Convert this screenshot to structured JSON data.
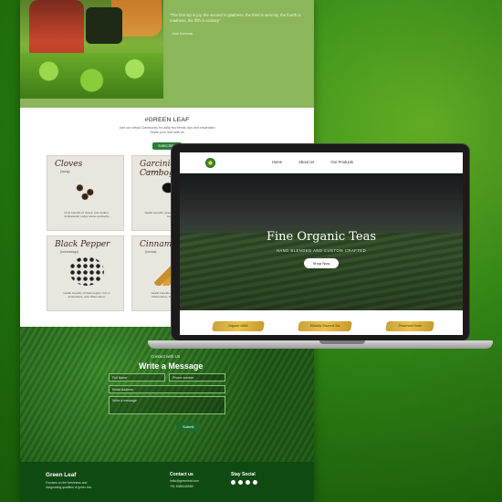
{
  "hero": {
    "quote": "\"The first sip is joy, the second is gladness, the third is serenity, the fourth is madness, the fifth is ecstasy\"",
    "author": "- Jack Kerouac"
  },
  "green_leaf_section": {
    "title": "#GREEN LEAF",
    "subtitle_line1": "Join our virtual Community for daily tea trends, tips and inspiration",
    "subtitle_line2": "Share your love with us",
    "subscribe_label": "SUBSCRIBE"
  },
  "products": [
    {
      "name": "Cloves",
      "subtitle": "(laung)",
      "desc": "Knife benefits of cloves: Anti-oxidant, Antibacterial, Helps relieve toothache"
    },
    {
      "name": "Garcinia Cambogia",
      "subtitle": "(kudampuli)",
      "desc": "Health benefits: Appetite control, weight loss support"
    },
    {
      "name": "Black Pepper",
      "subtitle": "(kurumulagu)",
      "desc": "Health benefits of black pepper: rich in antioxidants, anti-inflammatory"
    },
    {
      "name": "Cinnamon",
      "subtitle": "(kuruva)",
      "desc": "Health benefits of cinnamon: anti-inflammatory, lowers blood sugar"
    }
  ],
  "contact": {
    "small": "Contact with Us",
    "title": "Write a Message",
    "full_name": "Full Name",
    "phone": "Phone number",
    "email": "Email Address",
    "message": "Write a message",
    "submit_label": "Submit"
  },
  "footer": {
    "brand": "Green Leaf",
    "desc": "Focuses on the freshness and invigorating qualities of green tea.",
    "contact_title": "Contact us",
    "email": "hello@greenleaf.com",
    "phone": "+91 6385446968",
    "social_title": "Stay Social"
  },
  "laptop": {
    "nav": [
      "Home",
      "About Us",
      "Our Products"
    ],
    "banner_title": "Fine Organic Teas",
    "banner_sub": "HAND BLENDED AND CUSTOM CRAFTED",
    "shop_label": "Shop Now",
    "badges": [
      "Organic 100%",
      "Ethically Sourced Tea",
      "Preserved Fresh"
    ]
  },
  "colors": {
    "background_green": "#2f8a14",
    "footer_green": "#0f4a12",
    "button_green": "#2a7c3a",
    "badge_gold": "#e8c24a"
  }
}
